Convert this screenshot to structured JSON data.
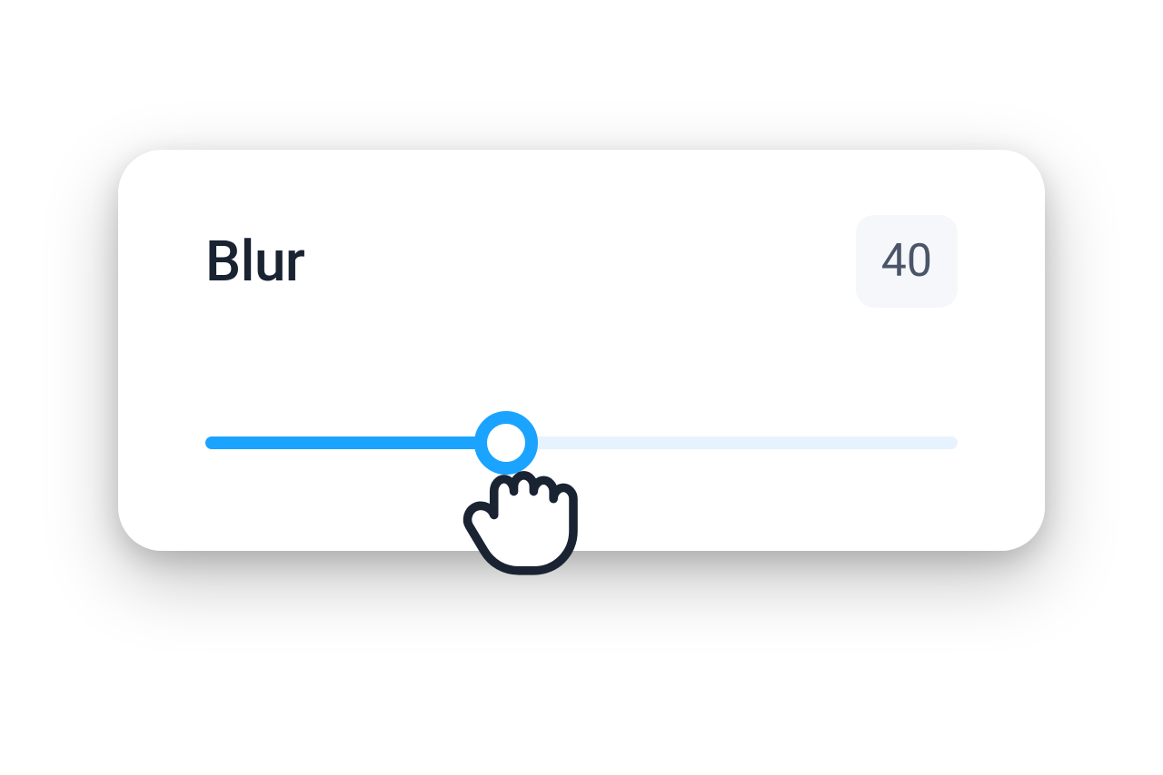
{
  "slider": {
    "label": "Blur",
    "value": "40",
    "percent": 40,
    "colors": {
      "accent": "#1aa3ff",
      "track": "#e6f3ff",
      "text": "#1a2332",
      "badge_bg": "#f5f7fa",
      "badge_text": "#4a5568"
    }
  }
}
